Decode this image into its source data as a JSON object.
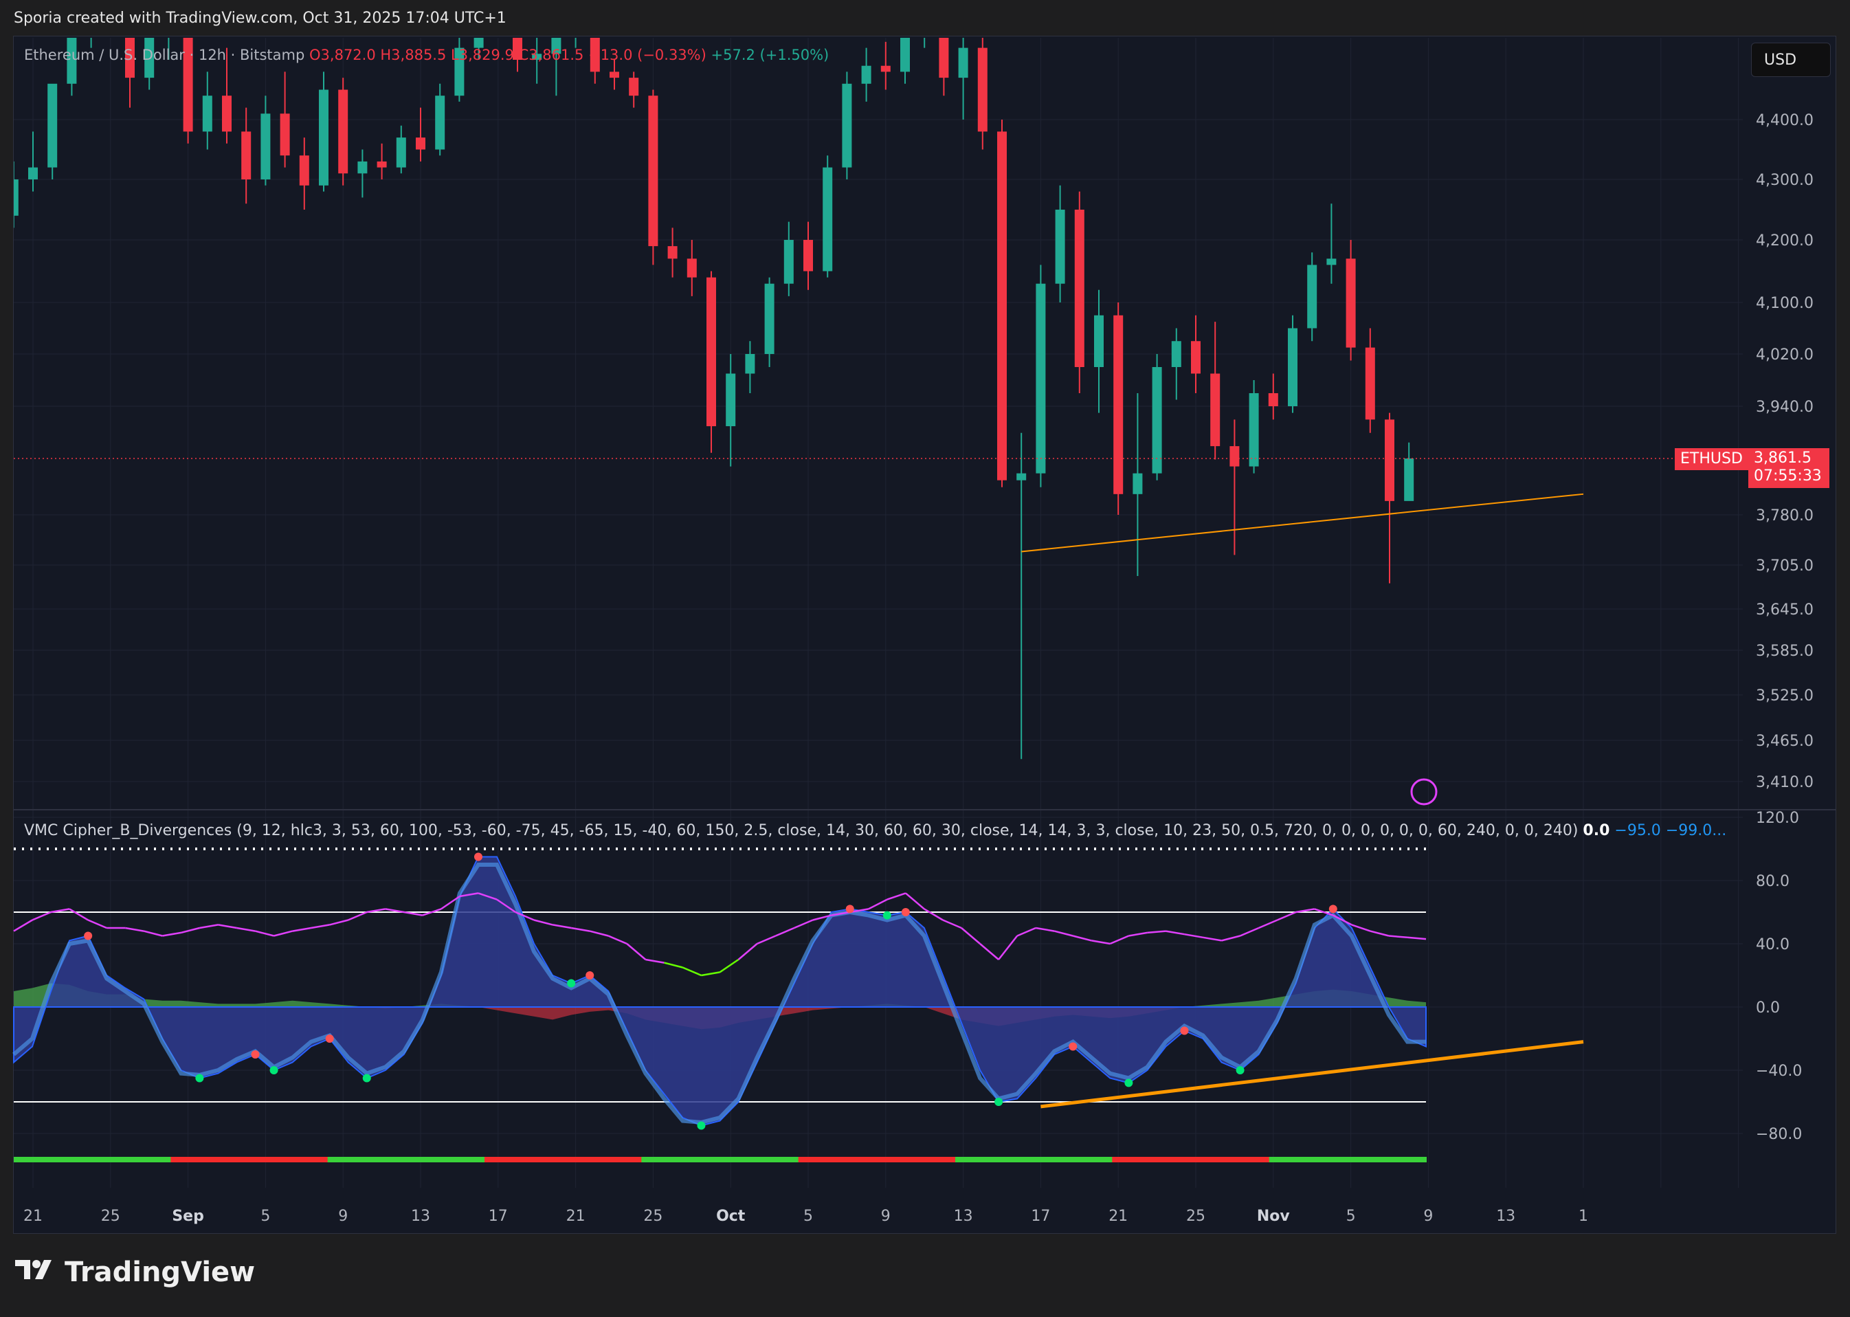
{
  "header": {
    "text": "Sporia created with TradingView.com, Oct 31, 2025 17:04 UTC+1"
  },
  "legend": {
    "symbol": "Ethereum / U.S. Dollar · 12h · Bitstamp",
    "o": "O3,872.0",
    "h": "H3,885.5",
    "l": "L3,829.9",
    "c": "C3,861.5",
    "change": "−13.0 (−0.33%)",
    "vol": "+57.2 (+1.50%)"
  },
  "currency": "USD",
  "price_tag": {
    "symbol": "ETHUSD",
    "price": "3,861.5",
    "timer": "07:55:33"
  },
  "osc_legend": {
    "label": "VMC Cipher_B_Divergences (9, 12, hlc3, 3, 53, 60, 100, -53, -60, -75, 45, -65, 15, -40, 60, 150, 2.5, close, 14, 30, 60, 60, 30, close, 14, 14, 3, 3, close, 10, 23, 50, 0.5, 720, 0, 0, 0, 0, 0, 0, 60, 240, 0, 0, 240)",
    "v1": "0.0",
    "v2": "−95.0",
    "v3": "−99.0..."
  },
  "logo": "TradingView",
  "colors": {
    "up": "#22ab94",
    "down": "#f23645",
    "bg": "#141824",
    "trend": "#ff9800"
  },
  "chart_data": [
    {
      "type": "candlestick",
      "title": "Ethereum / U.S. Dollar · 12h · Bitstamp",
      "interval": "12h",
      "y_axis_ticks": [
        "4,400.0",
        "4,300.0",
        "4,200.0",
        "4,100.0",
        "4,020.0",
        "3,940.0",
        "3,780.0",
        "3,705.0",
        "3,645.0",
        "3,585.0",
        "3,525.0",
        "3,465.0",
        "3,410.0"
      ],
      "x_axis_ticks": [
        "21",
        "25",
        "Sep",
        "5",
        "9",
        "13",
        "17",
        "21",
        "25",
        "Oct",
        "5",
        "9",
        "13",
        "17",
        "21",
        "25",
        "Nov",
        "5",
        "9",
        "13",
        "1"
      ],
      "last_price": 3861.5,
      "trendline": {
        "from": [
          "2025-10-11",
          3725
        ],
        "to": [
          "2025-11-09",
          3810
        ]
      },
      "series": [
        {
          "name": "candles",
          "data": [
            [
              "2025-08-20",
              4240,
              4330,
              4220,
              4300
            ],
            [
              "2025-08-21",
              4300,
              4380,
              4280,
              4320
            ],
            [
              "2025-08-22",
              4320,
              4420,
              4300,
              4460
            ],
            [
              "2025-08-23",
              4460,
              4580,
              4440,
              4540
            ],
            [
              "2025-08-24",
              4540,
              4720,
              4520,
              4660
            ],
            [
              "2025-08-25",
              4660,
              4730,
              4560,
              4600
            ],
            [
              "2025-08-26",
              4600,
              4650,
              4420,
              4470
            ],
            [
              "2025-08-27",
              4470,
              4600,
              4450,
              4560
            ],
            [
              "2025-08-28",
              4560,
              4620,
              4500,
              4590
            ],
            [
              "2025-08-29",
              4590,
              4600,
              4360,
              4380
            ],
            [
              "2025-08-30",
              4380,
              4480,
              4350,
              4440
            ],
            [
              "2025-08-31",
              4440,
              4520,
              4360,
              4380
            ],
            [
              "2025-09-01",
              4380,
              4420,
              4260,
              4300
            ],
            [
              "2025-09-02",
              4300,
              4440,
              4290,
              4410
            ],
            [
              "2025-09-03",
              4410,
              4480,
              4320,
              4340
            ],
            [
              "2025-09-04",
              4340,
              4370,
              4250,
              4290
            ],
            [
              "2025-09-05",
              4290,
              4480,
              4280,
              4450
            ],
            [
              "2025-09-06",
              4450,
              4470,
              4290,
              4310
            ],
            [
              "2025-09-07",
              4310,
              4350,
              4270,
              4330
            ],
            [
              "2025-09-08",
              4330,
              4360,
              4300,
              4320
            ],
            [
              "2025-09-09",
              4320,
              4390,
              4310,
              4370
            ],
            [
              "2025-09-10",
              4370,
              4420,
              4330,
              4350
            ],
            [
              "2025-09-11",
              4350,
              4460,
              4340,
              4440
            ],
            [
              "2025-09-12",
              4440,
              4560,
              4430,
              4520
            ],
            [
              "2025-09-13",
              4520,
              4640,
              4500,
              4610
            ],
            [
              "2025-09-14",
              4610,
              4660,
              4560,
              4590
            ],
            [
              "2025-09-15",
              4590,
              4620,
              4480,
              4500
            ],
            [
              "2025-09-16",
              4500,
              4540,
              4460,
              4510
            ],
            [
              "2025-09-17",
              4510,
              4580,
              4440,
              4550
            ],
            [
              "2025-09-18",
              4550,
              4620,
              4520,
              4600
            ],
            [
              "2025-09-19",
              4600,
              4610,
              4460,
              4480
            ],
            [
              "2025-09-20",
              4480,
              4500,
              4450,
              4470
            ],
            [
              "2025-09-21",
              4470,
              4480,
              4420,
              4440
            ],
            [
              "2025-09-22",
              4440,
              4450,
              4160,
              4190
            ],
            [
              "2025-09-23",
              4190,
              4220,
              4140,
              4170
            ],
            [
              "2025-09-24",
              4170,
              4200,
              4110,
              4140
            ],
            [
              "2025-09-25",
              4140,
              4150,
              3870,
              3910
            ],
            [
              "2025-09-26",
              3910,
              4020,
              3850,
              3990
            ],
            [
              "2025-09-27",
              3990,
              4040,
              3960,
              4020
            ],
            [
              "2025-09-28",
              4020,
              4140,
              4000,
              4130
            ],
            [
              "2025-09-29",
              4130,
              4230,
              4110,
              4200
            ],
            [
              "2025-09-30",
              4200,
              4230,
              4120,
              4150
            ],
            [
              "2025-10-01",
              4150,
              4340,
              4140,
              4320
            ],
            [
              "2025-10-02",
              4320,
              4480,
              4300,
              4460
            ],
            [
              "2025-10-03",
              4460,
              4520,
              4430,
              4490
            ],
            [
              "2025-10-04",
              4490,
              4530,
              4450,
              4480
            ],
            [
              "2025-10-05",
              4480,
              4560,
              4460,
              4540
            ],
            [
              "2025-10-06",
              4540,
              4700,
              4520,
              4670
            ],
            [
              "2025-10-07",
              4670,
              4700,
              4440,
              4470
            ],
            [
              "2025-10-08",
              4470,
              4540,
              4400,
              4520
            ],
            [
              "2025-10-09",
              4520,
              4550,
              4350,
              4380
            ],
            [
              "2025-10-10",
              4380,
              4400,
              3820,
              3830
            ],
            [
              "2025-10-11",
              3830,
              3900,
              3440,
              3840
            ],
            [
              "2025-10-12",
              3840,
              4160,
              3820,
              4130
            ],
            [
              "2025-10-13",
              4130,
              4290,
              4100,
              4250
            ],
            [
              "2025-10-14",
              4250,
              4280,
              3960,
              4000
            ],
            [
              "2025-10-15",
              4000,
              4120,
              3930,
              4080
            ],
            [
              "2025-10-16",
              4080,
              4100,
              3780,
              3810
            ],
            [
              "2025-10-17",
              3810,
              3960,
              3690,
              3840
            ],
            [
              "2025-10-18",
              3840,
              4020,
              3830,
              4000
            ],
            [
              "2025-10-19",
              4000,
              4060,
              3950,
              4040
            ],
            [
              "2025-10-20",
              4040,
              4080,
              3960,
              3990
            ],
            [
              "2025-10-21",
              3990,
              4070,
              3860,
              3880
            ],
            [
              "2025-10-22",
              3880,
              3920,
              3720,
              3850
            ],
            [
              "2025-10-23",
              3850,
              3980,
              3840,
              3960
            ],
            [
              "2025-10-24",
              3960,
              3990,
              3920,
              3940
            ],
            [
              "2025-10-25",
              3940,
              4080,
              3930,
              4060
            ],
            [
              "2025-10-26",
              4060,
              4180,
              4040,
              4160
            ],
            [
              "2025-10-27",
              4160,
              4260,
              4130,
              4170
            ],
            [
              "2025-10-28",
              4170,
              4200,
              4010,
              4030
            ],
            [
              "2025-10-29",
              4030,
              4060,
              3900,
              3920
            ],
            [
              "2025-10-30",
              3920,
              3930,
              3680,
              3800
            ],
            [
              "2025-10-31",
              3800,
              3885.5,
              3829.9,
              3861.5
            ]
          ]
        }
      ]
    },
    {
      "type": "line",
      "title": "VMC Cipher_B_Divergences",
      "y_axis_ticks": [
        "120.0",
        "80.0",
        "40.0",
        "0.0",
        "−40.0",
        "−80.0"
      ],
      "levels": [
        60,
        -60,
        100
      ],
      "series": [
        {
          "name": "wave1",
          "values": [
            -35,
            -25,
            10,
            42,
            45,
            20,
            12,
            5,
            -20,
            -40,
            -45,
            -42,
            -35,
            -30,
            -40,
            -35,
            -25,
            -20,
            -35,
            -45,
            -40,
            -30,
            -10,
            20,
            70,
            95,
            95,
            70,
            40,
            20,
            15,
            20,
            10,
            -15,
            -40,
            -55,
            -70,
            -75,
            -72,
            -60,
            -35,
            -10,
            15,
            40,
            60,
            62,
            60,
            58,
            60,
            50,
            20,
            -10,
            -40,
            -60,
            -58,
            -45,
            -30,
            -25,
            -35,
            -45,
            -48,
            -40,
            -25,
            -15,
            -20,
            -35,
            -40,
            -30,
            -10,
            15,
            50,
            62,
            50,
            25,
            0,
            -20,
            -25
          ]
        },
        {
          "name": "wave2",
          "values": [
            -30,
            -20,
            15,
            40,
            42,
            18,
            10,
            2,
            -22,
            -42,
            -43,
            -40,
            -33,
            -28,
            -38,
            -32,
            -22,
            -18,
            -32,
            -42,
            -38,
            -28,
            -8,
            22,
            72,
            90,
            90,
            65,
            35,
            18,
            12,
            18,
            8,
            -18,
            -42,
            -58,
            -72,
            -73,
            -70,
            -58,
            -32,
            -8,
            18,
            42,
            58,
            60,
            58,
            55,
            58,
            45,
            15,
            -15,
            -45,
            -58,
            -55,
            -42,
            -28,
            -22,
            -32,
            -42,
            -45,
            -38,
            -22,
            -12,
            -18,
            -32,
            -38,
            -28,
            -8,
            18,
            52,
            58,
            45,
            20,
            -5,
            -22,
            -22
          ]
        },
        {
          "name": "mfi",
          "values": [
            10,
            12,
            15,
            14,
            10,
            8,
            8,
            5,
            4,
            4,
            3,
            2,
            2,
            2,
            3,
            4,
            3,
            2,
            1,
            0,
            -1,
            0,
            1,
            2,
            1,
            0,
            -2,
            -4,
            -6,
            -8,
            -5,
            -3,
            -2,
            -4,
            -8,
            -10,
            -12,
            -14,
            -13,
            -10,
            -8,
            -6,
            -4,
            -2,
            -1,
            0,
            1,
            2,
            1,
            0,
            -4,
            -8,
            -10,
            -12,
            -10,
            -8,
            -6,
            -5,
            -6,
            -7,
            -6,
            -4,
            -2,
            0,
            1,
            2,
            3,
            4,
            6,
            8,
            10,
            11,
            10,
            8,
            6,
            4,
            3
          ]
        },
        {
          "name": "rsi",
          "values": [
            48,
            55,
            60,
            62,
            55,
            50,
            50,
            48,
            45,
            47,
            50,
            52,
            50,
            48,
            45,
            48,
            50,
            52,
            55,
            60,
            62,
            60,
            58,
            62,
            70,
            72,
            68,
            60,
            55,
            52,
            50,
            48,
            45,
            40,
            30,
            28,
            25,
            20,
            22,
            30,
            40,
            45,
            50,
            55,
            58,
            60,
            62,
            68,
            72,
            62,
            55,
            50,
            40,
            30,
            45,
            50,
            48,
            45,
            42,
            40,
            45,
            47,
            48,
            46,
            44,
            42,
            45,
            50,
            55,
            60,
            62,
            58,
            52,
            48,
            45,
            44,
            43
          ]
        }
      ],
      "dots": {
        "green": 18,
        "red": 16
      },
      "trendline": {
        "from": [
          "2025-10-12",
          -63
        ],
        "to": [
          "2025-11-09",
          -22
        ]
      },
      "bar_strip": [
        "green",
        "red",
        "green",
        "red",
        "green",
        "red",
        "green",
        "red",
        "green"
      ]
    }
  ]
}
